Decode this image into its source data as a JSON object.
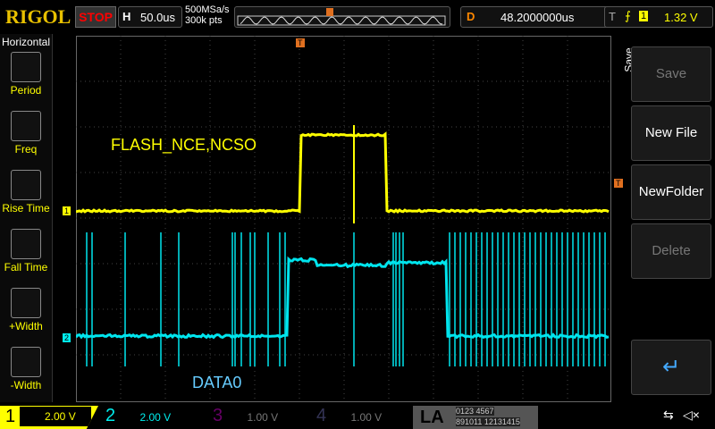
{
  "header": {
    "logo": "RIGOL",
    "run_state": "STOP",
    "h_label": "H",
    "timebase": "50.0us",
    "sample_rate": "500MSa/s",
    "memory_depth": "300k pts",
    "d_label": "D",
    "delay": "48.2000000us",
    "t_label": "T",
    "trigger_source": "1",
    "trigger_level": "1.32 V"
  },
  "left_menu": {
    "title": "Horizontal",
    "items": [
      {
        "label": "Period"
      },
      {
        "label": "Freq"
      },
      {
        "label": "Rise Time"
      },
      {
        "label": "Fall Time"
      },
      {
        "label": "+Width"
      },
      {
        "label": "-Width"
      }
    ]
  },
  "right_menu": {
    "title": "Save",
    "items": [
      {
        "label": "Save",
        "enabled": false
      },
      {
        "label": "New File",
        "enabled": true
      },
      {
        "label": "NewFolder",
        "enabled": true
      },
      {
        "label": "Delete",
        "enabled": false
      }
    ],
    "enter_icon": "return-arrow-icon"
  },
  "screen": {
    "annotation1": "FLASH_NCE,NCSO",
    "annotation2": "DATA0",
    "ch1_marker": "1",
    "ch2_marker": "2",
    "trigger_marker": "T"
  },
  "channels": [
    {
      "num": "1",
      "scale": "2.00 V",
      "color": "#ffff00"
    },
    {
      "num": "2",
      "scale": "2.00 V",
      "color": "#00e5ee"
    },
    {
      "num": "3",
      "scale": "1.00 V",
      "color": "#c000c0"
    },
    {
      "num": "4",
      "scale": "1.00 V",
      "color": "#3070ff"
    }
  ],
  "la": {
    "label": "LA",
    "row1": "0123 4567",
    "row2": "891011 12131415"
  },
  "status_icons": [
    "usb-icon",
    "speaker-mute-icon"
  ]
}
